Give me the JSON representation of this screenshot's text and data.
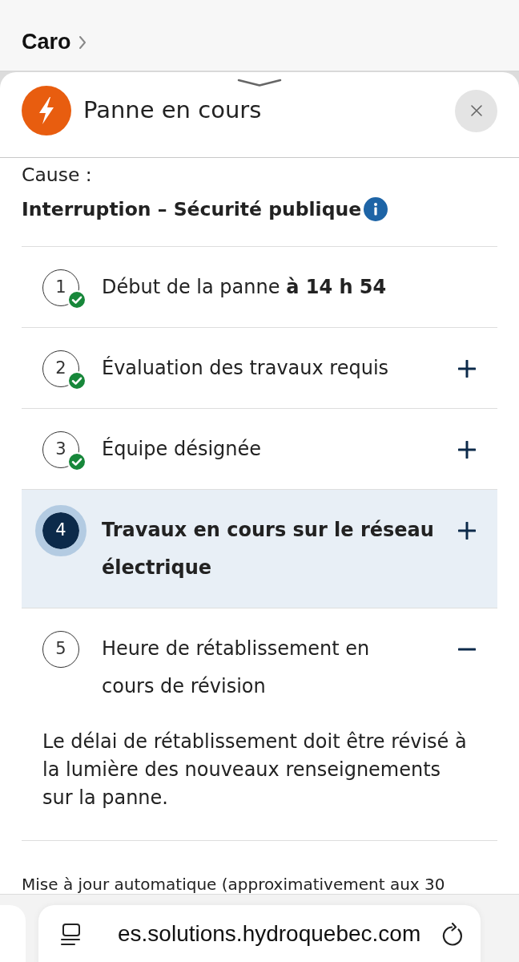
{
  "top_bar": {
    "title": "Caro"
  },
  "sheet": {
    "title": "Panne en cours"
  },
  "cause": {
    "label": "Cause :",
    "value": "Interruption – Sécurité publique"
  },
  "steps": [
    {
      "number": "1",
      "text": "Début de la panne **à 14 h 54**",
      "completed": true,
      "current": false
    },
    {
      "number": "2",
      "text": "Évaluation des travaux requis",
      "completed": true,
      "current": false,
      "expanded": false
    },
    {
      "number": "3",
      "text": "Équipe désignée",
      "completed": true,
      "current": false,
      "expanded": false
    },
    {
      "number": "4",
      "text": "Travaux en cours sur le réseau électrique",
      "completed": false,
      "current": true,
      "expanded": false
    },
    {
      "number": "5",
      "text": "Heure de rétablissement en cours de révision",
      "completed": false,
      "current": false,
      "expanded": true,
      "detail": "Le délai de rétablissement doit être révisé à la lumière des nouveaux renseignements sur la panne."
    }
  ],
  "update_note": "Mise à jour automatique (approximativement aux 30",
  "browser_bar": {
    "url": "es.solutions.hydroquebec.com"
  }
}
